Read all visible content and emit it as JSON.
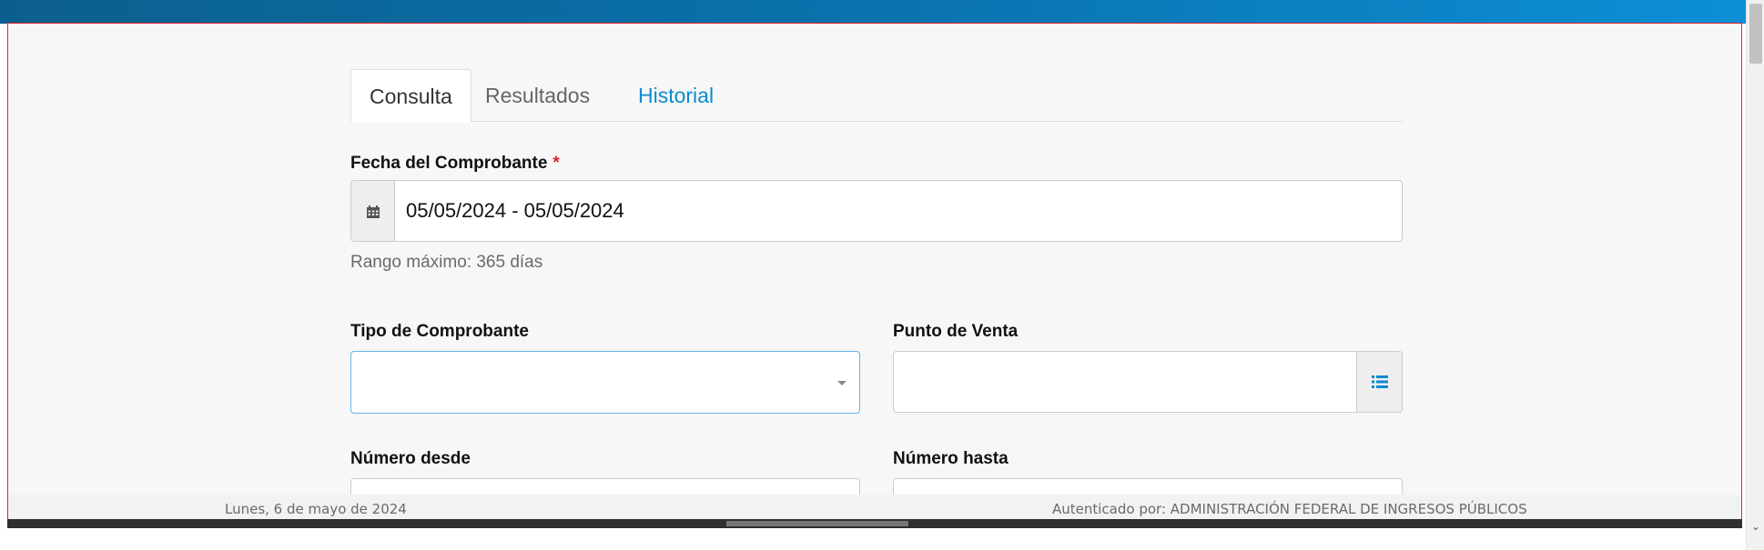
{
  "tabs": [
    {
      "label": "Consulta",
      "active": true
    },
    {
      "label": "Resultados",
      "active": false
    },
    {
      "label": "Historial",
      "active": false
    }
  ],
  "form": {
    "fecha_label": "Fecha del Comprobante",
    "required_mark": "*",
    "fecha_value": "05/05/2024 - 05/05/2024",
    "fecha_help": "Rango máximo: 365 días",
    "tipo_label": "Tipo de Comprobante",
    "tipo_value": "",
    "punto_label": "Punto de Venta",
    "punto_value": "",
    "numero_desde_label": "Número desde",
    "numero_hasta_label": "Número hasta"
  },
  "footer": {
    "date_text": "Lunes, 6 de mayo de 2024",
    "auth_text": "Autenticado por: ADMINISTRACIÓN FEDERAL DE INGRESOS PÚBLICOS"
  },
  "colors": {
    "accent": "#0a8bd2",
    "required": "#e0252b",
    "header_gradient_start": "#0b5f8e",
    "header_gradient_end": "#0d8fd6"
  },
  "icons": {
    "date_addon": "calendar-icon",
    "punto_addon": "list-icon",
    "select_caret": "caret-down-icon"
  }
}
